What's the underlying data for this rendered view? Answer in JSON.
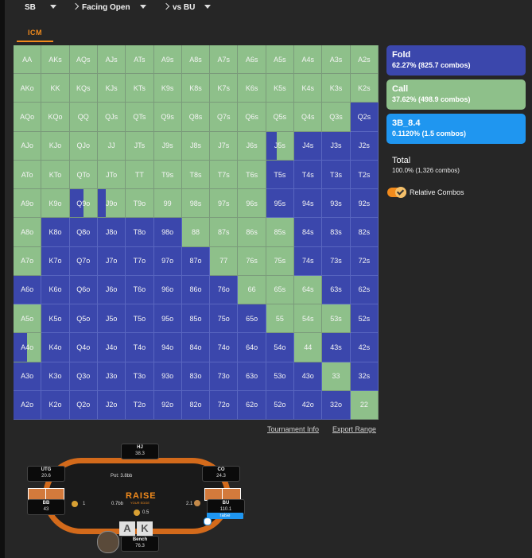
{
  "header": {
    "position": "SB",
    "scenario": "Facing Open",
    "opponent": "vs BU"
  },
  "tabs": [
    {
      "label": "ICM",
      "active": true
    }
  ],
  "colors": {
    "fold": "#3b47ac",
    "call": "#8ec08a",
    "raise": "#1f96f0",
    "accent": "#f28b1c"
  },
  "grid": {
    "rows": [
      [
        "AA",
        "AKs",
        "AQs",
        "AJs",
        "ATs",
        "A9s",
        "A8s",
        "A7s",
        "A6s",
        "A5s",
        "A4s",
        "A3s",
        "A2s"
      ],
      [
        "AKo",
        "KK",
        "KQs",
        "KJs",
        "KTs",
        "K9s",
        "K8s",
        "K7s",
        "K6s",
        "K5s",
        "K4s",
        "K3s",
        "K2s"
      ],
      [
        "AQo",
        "KQo",
        "QQ",
        "QJs",
        "QTs",
        "Q9s",
        "Q8s",
        "Q7s",
        "Q6s",
        "Q5s",
        "Q4s",
        "Q3s",
        "Q2s"
      ],
      [
        "AJo",
        "KJo",
        "QJo",
        "JJ",
        "JTs",
        "J9s",
        "J8s",
        "J7s",
        "J6s",
        "J5s",
        "J4s",
        "J3s",
        "J2s"
      ],
      [
        "ATo",
        "KTo",
        "QTo",
        "JTo",
        "TT",
        "T9s",
        "T8s",
        "T7s",
        "T6s",
        "T5s",
        "T4s",
        "T3s",
        "T2s"
      ],
      [
        "A9o",
        "K9o",
        "Q9o",
        "J9o",
        "T9o",
        "99",
        "98s",
        "97s",
        "96s",
        "95s",
        "94s",
        "93s",
        "92s"
      ],
      [
        "A8o",
        "K8o",
        "Q8o",
        "J8o",
        "T8o",
        "98o",
        "88",
        "87s",
        "86s",
        "85s",
        "84s",
        "83s",
        "82s"
      ],
      [
        "A7o",
        "K7o",
        "Q7o",
        "J7o",
        "T7o",
        "97o",
        "87o",
        "77",
        "76s",
        "75s",
        "74s",
        "73s",
        "72s"
      ],
      [
        "A6o",
        "K6o",
        "Q6o",
        "J6o",
        "T6o",
        "96o",
        "86o",
        "76o",
        "66",
        "65s",
        "64s",
        "63s",
        "62s"
      ],
      [
        "A5o",
        "K5o",
        "Q5o",
        "J5o",
        "T5o",
        "95o",
        "85o",
        "75o",
        "65o",
        "55",
        "54s",
        "53s",
        "52s"
      ],
      [
        "A4o",
        "K4o",
        "Q4o",
        "J4o",
        "T4o",
        "94o",
        "84o",
        "74o",
        "64o",
        "54o",
        "44",
        "43s",
        "42s"
      ],
      [
        "A3o",
        "K3o",
        "Q3o",
        "J3o",
        "T3o",
        "93o",
        "83o",
        "73o",
        "63o",
        "53o",
        "43o",
        "33",
        "32s"
      ],
      [
        "A2o",
        "K2o",
        "Q2o",
        "J2o",
        "T2o",
        "92o",
        "82o",
        "72o",
        "62o",
        "52o",
        "42o",
        "32o",
        "22"
      ]
    ],
    "fold_fraction": [
      [
        0,
        0,
        0,
        0,
        0,
        0,
        0,
        0,
        0,
        0,
        0,
        0,
        0
      ],
      [
        0,
        0,
        0,
        0,
        0,
        0,
        0,
        0,
        0,
        0,
        0,
        0,
        0
      ],
      [
        0,
        0,
        0,
        0,
        0,
        0,
        0,
        0,
        0,
        0,
        0,
        0,
        1
      ],
      [
        0,
        0,
        0,
        0,
        0,
        0,
        0,
        0,
        0,
        0.4,
        1,
        1,
        1
      ],
      [
        0,
        0,
        0,
        0,
        0,
        0,
        0,
        0,
        0,
        1,
        1,
        1,
        1
      ],
      [
        0,
        0,
        0.5,
        0.3,
        0,
        0,
        0,
        0,
        0,
        1,
        1,
        1,
        1
      ],
      [
        0,
        1,
        1,
        1,
        1,
        1,
        0,
        0,
        0,
        0,
        1,
        1,
        1
      ],
      [
        0,
        1,
        1,
        1,
        1,
        1,
        1,
        0,
        0,
        0,
        1,
        1,
        1
      ],
      [
        1,
        1,
        1,
        1,
        1,
        1,
        1,
        1,
        0,
        0,
        0,
        1,
        1
      ],
      [
        0,
        1,
        1,
        1,
        1,
        1,
        1,
        1,
        1,
        0,
        0,
        0,
        1
      ],
      [
        0.5,
        1,
        1,
        1,
        1,
        1,
        1,
        1,
        1,
        1,
        0,
        1,
        1
      ],
      [
        1,
        1,
        1,
        1,
        1,
        1,
        1,
        1,
        1,
        1,
        1,
        0,
        1
      ],
      [
        1,
        1,
        1,
        1,
        1,
        1,
        1,
        1,
        1,
        1,
        1,
        1,
        0
      ]
    ]
  },
  "actions": [
    {
      "name": "Fold",
      "pct": "62.27% (825.7 combos)",
      "type": "fold"
    },
    {
      "name": "Call",
      "pct": "37.62% (498.9 combos)",
      "type": "call"
    },
    {
      "name": "3B_8.4",
      "pct": "0.1120% (1.5 combos)",
      "type": "raise"
    }
  ],
  "total": {
    "label": "Total",
    "value": "100.0% (1,326 combos)"
  },
  "toggle": {
    "label": "Relative Combos",
    "on": true
  },
  "links": {
    "tournament": "Tournament Info",
    "export": "Export Range"
  },
  "table": {
    "logo": "RAISE",
    "logo_sub": "YOUR EDGE",
    "pot": "Pot: 3.8bb",
    "seats": {
      "hj": {
        "name": "HJ",
        "stack": "38.3"
      },
      "utg": {
        "name": "UTG",
        "stack": "20.6"
      },
      "co": {
        "name": "CO",
        "stack": "24.3"
      },
      "bb": {
        "name": "BB",
        "stack": "43"
      },
      "bu": {
        "name": "BU",
        "stack": "110.1"
      },
      "hero": {
        "name": "Bench",
        "stack": "76.3"
      }
    },
    "bets": {
      "bb": "1",
      "sb": "0.5",
      "center": "0.7bb",
      "bu": "2.1"
    },
    "hero_cards": [
      "A",
      "K"
    ],
    "bu_action": "raise"
  }
}
